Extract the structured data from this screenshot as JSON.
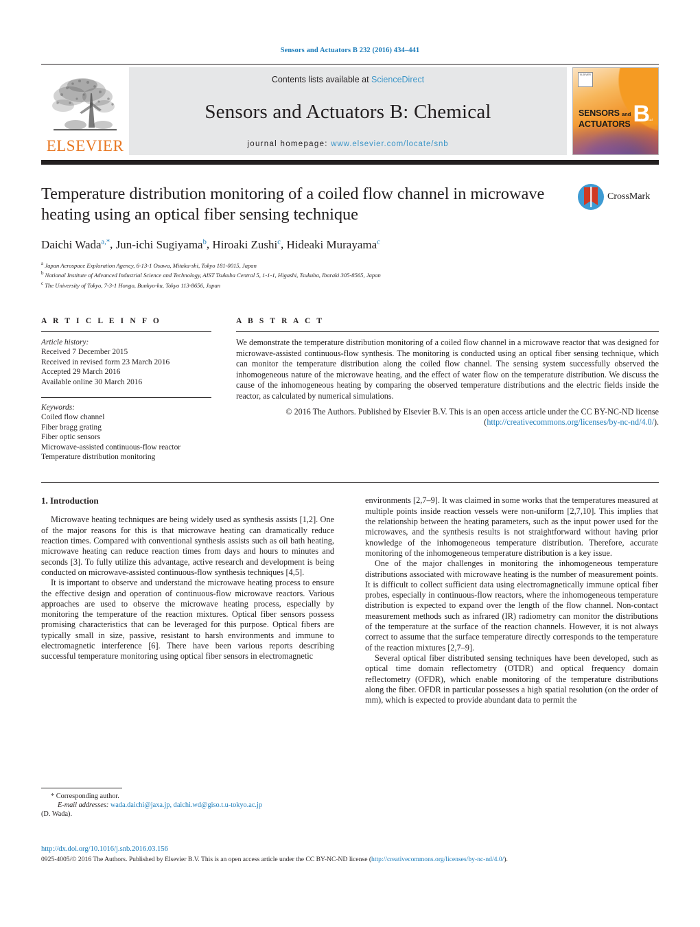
{
  "running_head": "Sensors and Actuators B 232 (2016) 434–441",
  "banner": {
    "contents_prefix": "Contents lists available at ",
    "contents_link": "ScienceDirect",
    "journal_title": "Sensors and Actuators B: Chemical",
    "homepage_prefix": "journal homepage: ",
    "homepage_url": "www.elsevier.com/locate/snb",
    "publisher_logo_text": "ELSEVIER",
    "cover": {
      "line1": "SENSORS",
      "and": "and",
      "line2": "ACTUATORS",
      "letter": "B",
      "sub": "Chemical",
      "corner_box": "ELSEVIER"
    }
  },
  "article": {
    "title": "Temperature distribution monitoring of a coiled flow channel in microwave heating using an optical fiber sensing technique",
    "authors": [
      {
        "name": "Daichi Wada",
        "marks": "a,*"
      },
      {
        "name": "Jun-ichi Sugiyama",
        "marks": "b"
      },
      {
        "name": "Hiroaki Zushi",
        "marks": "c"
      },
      {
        "name": "Hideaki Murayama",
        "marks": "c"
      }
    ],
    "affiliations": [
      {
        "mark": "a",
        "text": "Japan Aerospace Exploration Agency, 6-13-1 Osawa, Mitaka-shi, Tokyo 181-0015, Japan"
      },
      {
        "mark": "b",
        "text": "National Institute of Advanced Industrial Science and Technology, AIST Tsukuba Central 5, 1-1-1, Higashi, Tsukuba, Ibaraki 305-8565, Japan"
      },
      {
        "mark": "c",
        "text": "The University of Tokyo, 7-3-1 Hongo, Bunkyo-ku, Tokyo 113-8656, Japan"
      }
    ],
    "crossmark_label": "CrossMark"
  },
  "info": {
    "heading": "A R T I C L E   I N F O",
    "history_label": "Article history:",
    "history": [
      "Received 7 December 2015",
      "Received in revised form 23 March 2016",
      "Accepted 29 March 2016",
      "Available online 30 March 2016"
    ],
    "keywords_label": "Keywords:",
    "keywords": [
      "Coiled flow channel",
      "Fiber bragg grating",
      "Fiber optic sensors",
      "Microwave-assisted continuous-flow reactor",
      "Temperature distribution monitoring"
    ]
  },
  "abstract": {
    "heading": "A B S T R A C T",
    "text": "We demonstrate the temperature distribution monitoring of a coiled flow channel in a microwave reactor that was designed for microwave-assisted continuous-flow synthesis. The monitoring is conducted using an optical fiber sensing technique, which can monitor the temperature distribution along the coiled flow channel. The sensing system successfully observed the inhomogeneous nature of the microwave heating, and the effect of water flow on the temperature distribution. We discuss the cause of the inhomogeneous heating by comparing the observed temperature distributions and the electric fields inside the reactor, as calculated by numerical simulations.",
    "copyright_pre": "© 2016 The Authors. Published by Elsevier B.V. This is an open access article under the CC BY-NC-ND license (",
    "copyright_link": "http://creativecommons.org/licenses/by-nc-nd/4.0/",
    "copyright_post": ")."
  },
  "body": {
    "section_number_title": "1.  Introduction",
    "left_paragraphs": [
      "Microwave heating techniques are being widely used as synthesis assists [1,2]. One of the major reasons for this is that microwave heating can dramatically reduce reaction times. Compared with conventional synthesis assists such as oil bath heating, microwave heating can reduce reaction times from days and hours to minutes and seconds [3]. To fully utilize this advantage, active research and development is being conducted on microwave-assisted continuous-flow synthesis techniques [4,5].",
      "It is important to observe and understand the microwave heating process to ensure the effective design and operation of continuous-flow microwave reactors. Various approaches are used to observe the microwave heating process, especially by monitoring the temperature of the reaction mixtures. Optical fiber sensors possess promising characteristics that can be leveraged for this purpose. Optical fibers are typically small in size, passive, resistant to harsh environments and immune to electromagnetic interference [6]. There have been various reports describing successful temperature monitoring using optical fiber sensors in electromagnetic"
    ],
    "right_paragraphs": [
      "environments [2,7–9]. It was claimed in some works that the temperatures measured at multiple points inside reaction vessels were non-uniform [2,7,10]. This implies that the relationship between the heating parameters, such as the input power used for the microwaves, and the synthesis results is not straightforward without having prior knowledge of the inhomogeneous temperature distribution. Therefore, accurate monitoring of the inhomogeneous temperature distribution is a key issue.",
      "One of the major challenges in monitoring the inhomogeneous temperature distributions associated with microwave heating is the number of measurement points. It is difficult to collect sufficient data using electromagnetically immune optical fiber probes, especially in continuous-flow reactors, where the inhomogeneous temperature distribution is expected to expand over the length of the flow channel. Non-contact measurement methods such as infrared (IR) radiometry can monitor the distributions of the temperature at the surface of the reaction channels. However, it is not always correct to assume that the surface temperature directly corresponds to the temperature of the reaction mixtures [2,7–9].",
      "Several optical fiber distributed sensing techniques have been developed, such as optical time domain reflectometry (OTDR) and optical frequency domain reflectometry (OFDR), which enable monitoring of the temperature distributions along the fiber. OFDR in particular possesses a high spatial resolution (on the order of mm), which is expected to provide abundant data to permit the"
    ]
  },
  "footnote": {
    "corresponding": "* Corresponding author.",
    "email_label": "E-mail addresses:",
    "emails": "wada.daichi@jaxa.jp, daichi.wd@giso.t.u-tokyo.ac.jp",
    "email_owner": "(D. Wada)."
  },
  "bottom": {
    "doi": "http://dx.doi.org/10.1016/j.snb.2016.03.156",
    "issn_pre": "0925-4005/© 2016 The Authors. Published by Elsevier B.V. This is an open access article under the CC BY-NC-ND license (",
    "issn_link": "http://creativecommons.org/licenses/by-nc-nd/4.0/",
    "issn_post": ")."
  },
  "colors": {
    "link": "#1a7bb9",
    "accent_orange": "#E87722",
    "rule": "#231f20",
    "banner_bg": "#e6e7e8"
  }
}
